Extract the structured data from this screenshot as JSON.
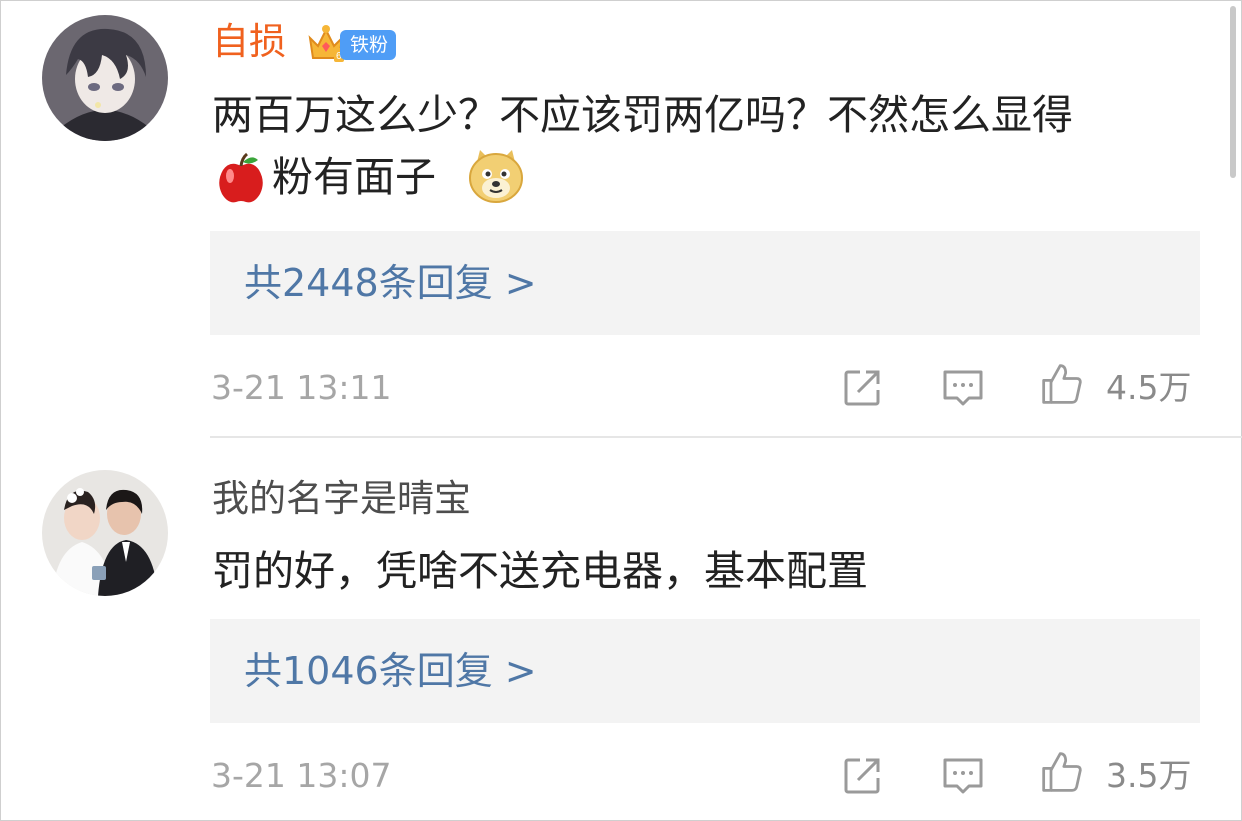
{
  "colors": {
    "username_highlight": "#f0611e",
    "username_normal": "#4d4d4d",
    "reply_link": "#4f77a6",
    "reply_box_bg": "#f3f3f3",
    "badge_bg": "#4f9df6",
    "meta_text": "#a6a6a6"
  },
  "comments": [
    {
      "username": "自损",
      "badge": {
        "icon": "crown-icon",
        "label": "铁粉"
      },
      "text_line1": "两百万这么少？不应该罚两亿吗？不然怎么显得",
      "text_line2": "粉有面子",
      "inline_emojis": [
        "apple-emoji",
        "doge-emoji"
      ],
      "replies_label": "共2448条回复 >",
      "timestamp": "3-21 13:11",
      "likes": "4.5万",
      "avatar": "anime-boy-avatar"
    },
    {
      "username": "我的名字是晴宝",
      "text": "罚的好，凭啥不送充电器，基本配置",
      "replies_label": "共1046条回复 >",
      "timestamp": "3-21 13:07",
      "likes": "3.5万",
      "avatar": "wedding-couple-avatar"
    }
  ],
  "actions": {
    "share_icon": "share-icon",
    "comment_icon": "comment-icon",
    "like_icon": "thumbs-up-icon"
  }
}
